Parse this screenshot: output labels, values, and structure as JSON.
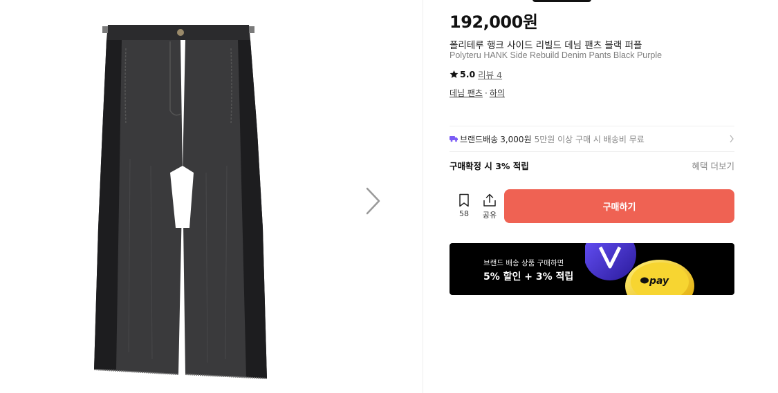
{
  "product": {
    "price": "192,000원",
    "name_ko": "폴리테루 행크 사이드 리빌드 데님 팬츠 블랙 퍼플",
    "name_en": "Polyteru HANK Side Rebuild Denim Pants Black Purple",
    "rating": "5.0",
    "review_label": "리뷰 4",
    "categories": [
      "데님 팬츠",
      "하의"
    ],
    "category_separator": "·"
  },
  "shipping": {
    "label": "브랜드배송",
    "fee": "3,000원",
    "note": "5만원 이상 구매 시 배송비 무료",
    "icon": "truck-icon"
  },
  "points": {
    "label": "구매확정 시 3% 적립",
    "benefits_link": "혜택 더보기"
  },
  "actions": {
    "bookmark_count": "58",
    "share_label": "공유",
    "buy_label": "구매하기"
  },
  "banner": {
    "subtitle": "브랜드 배송 상품 구매하면",
    "title": "5% 할인 + 3% 적립",
    "pay_text": "pay"
  },
  "colors": {
    "buy_button": "#ef6253",
    "shipping_icon": "#7b5cf5",
    "banner_bg": "#000000",
    "pay_coin": "#f7d531"
  }
}
